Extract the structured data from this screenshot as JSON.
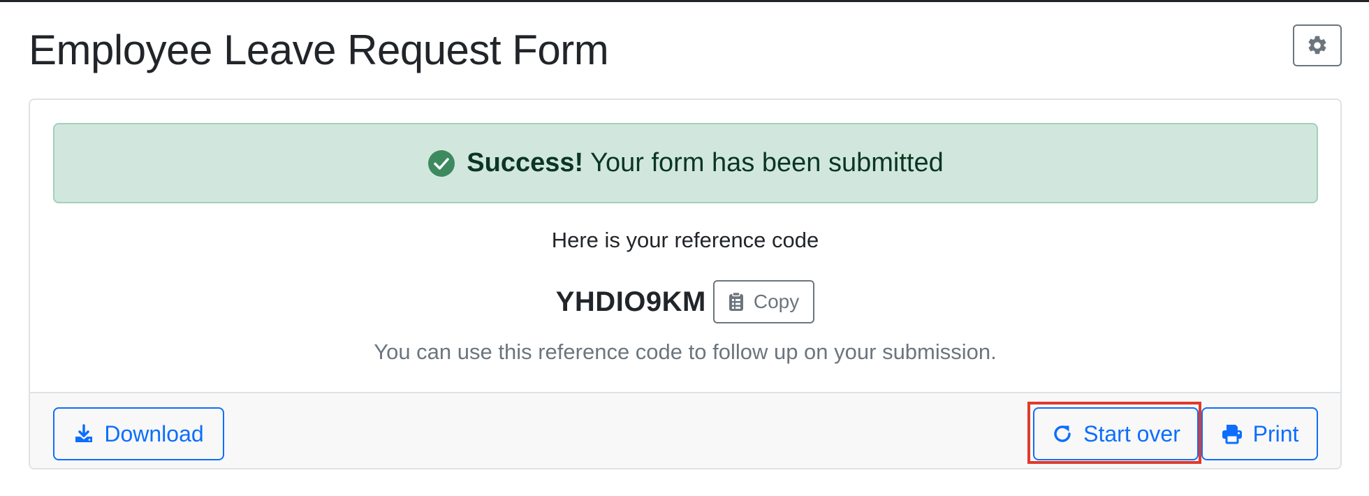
{
  "header": {
    "title": "Employee Leave Request Form",
    "settings_icon": "gear-icon"
  },
  "alert": {
    "icon": "check-circle-icon",
    "strong": "Success!",
    "message": "Your form has been submitted",
    "color": "#d1e7dd"
  },
  "reference": {
    "heading": "Here is your reference code",
    "code": "YHDIO9KM",
    "copy_label": "Copy",
    "note": "You can use this reference code to follow up on your submission."
  },
  "footer": {
    "download_label": "Download",
    "start_over_label": "Start over",
    "print_label": "Print"
  },
  "colors": {
    "primary": "#0d6efd",
    "highlight": "#e03a2b"
  }
}
